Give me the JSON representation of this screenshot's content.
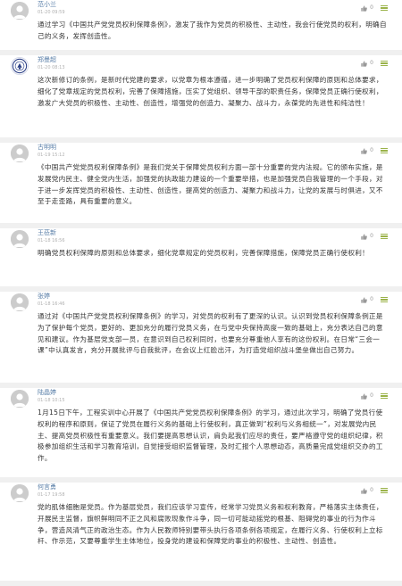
{
  "comments": [
    {
      "username": "范小兰",
      "time": "01-20 09:59",
      "likes": "0",
      "avatar": "default",
      "text": "通过学习《中国共产党党员权利保障条例》，激发了我作为党员的积极性、主动性，我会行使党员的权利，明确自己的义务，发挥创造性。"
    },
    {
      "username": "郑曼超",
      "time": "01-20 08:13",
      "likes": "0",
      "avatar": "logo",
      "text": "这次新修订的条例，是新时代党建的要求，以党章为根本遵循，进一步明确了党员权利保障的原则和总体要求，细化了党章规定的党员权利，完善了保障措施，压实了党组织、领导干部的职责任务，保障党员正确行使权利，激发广大党员的积极性、主动性、创造性，增强党的创造力、凝聚力、战斗力，永葆党的先进性和纯洁性！"
    },
    {
      "username": "古明明",
      "time": "01-19 15:12",
      "likes": "0",
      "avatar": "default",
      "text": "《中国共产党党员权利保障条例》是我们党关于保障党员权利方面一部十分重要的党内法规。它的颁布实施，是发展党内民主、健全党内生活，加强党的执政能力建设的一个重要举措，也是加强党员自我管理的一个手段，对于进一步发挥党员的积极性、主动性、创造性，提高党的创造力、凝聚力和战斗力，让党的发展与时俱进，又不至于走歪路，具有重要的意义。"
    },
    {
      "username": "王莅新",
      "time": "01-18 16:56",
      "likes": "0",
      "avatar": "default",
      "text": "明确党员权利保障的原则和总体要求，细化党章规定的党员权利，完善保障措施，保障党员正确行使权利！"
    },
    {
      "username": "张婷",
      "time": "01-18 16:46",
      "likes": "0",
      "avatar": "default",
      "text": "通过对《中国共产党党员权利保障条例》的学习，对党员的权利有了更深的认识。认识到党员权利保障条例正是为了保护每个党员，更好的、更加充分的履行党员义务，在与党中央保持高度一致的基础上，充分表达自己的意见和建议。作为基层党支部一员，在意识到自己权利同时，也要充分尊重他人享有的这份权利。在日常“三会一课”中认真发言，充分开展批评与自我批评，在会议上红脸出汗，为打造党组织战斗堡垒做出自己努力。"
    },
    {
      "username": "陆晶婷",
      "time": "01-18 10:15",
      "likes": "0",
      "avatar": "default",
      "text": "1月15日下午，工程实训中心开展了《中国共产党党员权利保障条例》的学习，通过此次学习，明确了党员行使权利的程序和原则，保证了党员在履行义务的基础上行使权利，真正做到“权利与义务相统一”，对发展党内民主、提高党员积极性有重要意义。我们要提高思想认识，肩负起我们应尽的责任，要严格遵守党的组织纪律，积极参加组织生活和学习教育培训，自觉接受组织监督管理，及时汇报个人思想动态，高质量完成党组织交办的工作。"
    },
    {
      "username": "何言勇",
      "time": "01-17 19:58",
      "likes": "0",
      "avatar": "default",
      "text": "党的肌体细胞是党员。作为基层党员，我们应该学习宣传，经常学习党员义务和权利教育，严格落实主体责任，开展民主监督，旗帜鲜明同不正之风和腐败现象作斗争，同一切可能动摇党的根基、阻碍党的事业的行为作斗争，营造风清气正的政治生态。作为人民教师特别要带头执行各项条例各项规定，在履行义务、行使权利上立标杆、作示范，又要尊重学生主体地位，投身党的建设和保障党的事业的积极性、主动性、创造性。"
    }
  ]
}
